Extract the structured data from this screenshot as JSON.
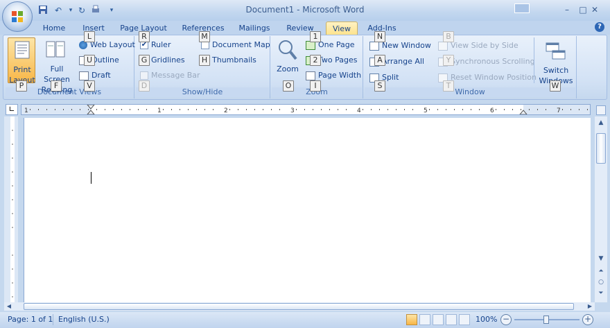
{
  "window": {
    "title": "Document1 - Microsoft Word"
  },
  "quick_access": [
    {
      "name": "save-icon",
      "glyph": "💾"
    },
    {
      "name": "undo-icon",
      "glyph": "↶"
    },
    {
      "name": "redo-icon",
      "glyph": "↻"
    },
    {
      "name": "format-painter-icon",
      "glyph": "🖌"
    },
    {
      "name": "customize-icon",
      "glyph": "▾"
    }
  ],
  "tabs": [
    "Home",
    "Insert",
    "Page Layout",
    "References",
    "Mailings",
    "Review",
    "View",
    "Add-Ins"
  ],
  "active_tab": "View",
  "groups": {
    "document_views": {
      "label": "Document Views",
      "print_layout": "Print Layout",
      "full_screen_reading": "Full Screen Reading",
      "web_layout": "Web Layout",
      "outline": "Outline",
      "draft": "Draft"
    },
    "show_hide": {
      "label": "Show/Hide",
      "ruler": "Ruler",
      "gridlines": "Gridlines",
      "message_bar": "Message Bar",
      "document_map": "Document Map",
      "thumbnails": "Thumbnails"
    },
    "zoom": {
      "label": "Zoom",
      "zoom": "Zoom",
      "one_page": "One Page",
      "two_pages": "Two Pages",
      "page_width": "Page Width"
    },
    "window": {
      "label": "Window",
      "new_window": "New Window",
      "arrange_all": "Arrange All",
      "split": "Split",
      "view_side_by_side": "View Side by Side",
      "synchronous_scrolling": "Synchronous Scrolling",
      "reset_window_position": "Reset Window Position",
      "switch_windows": "Switch Windows"
    }
  },
  "key_tips": {
    "L": "L",
    "R": "R",
    "M": "M",
    "1": "1",
    "N": "N",
    "B": "B",
    "U": "U",
    "G": "G",
    "H": "H",
    "2": "2",
    "A": "A",
    "Y": "Y",
    "V": "V",
    "P": "P",
    "F": "F",
    "D": "D",
    "O": "O",
    "I": "I",
    "S": "S",
    "T": "T",
    "W": "W"
  },
  "ruler_numbers": [
    "1",
    "1",
    "2",
    "3",
    "4",
    "5",
    "6",
    "7"
  ],
  "status": {
    "page": "Page: 1 of 1",
    "language": "English (U.S.)",
    "zoom": "100%"
  },
  "colors": {
    "active_tab": "#fde28a",
    "ribbon": "#d3e2f5",
    "accent": "#15428b"
  }
}
